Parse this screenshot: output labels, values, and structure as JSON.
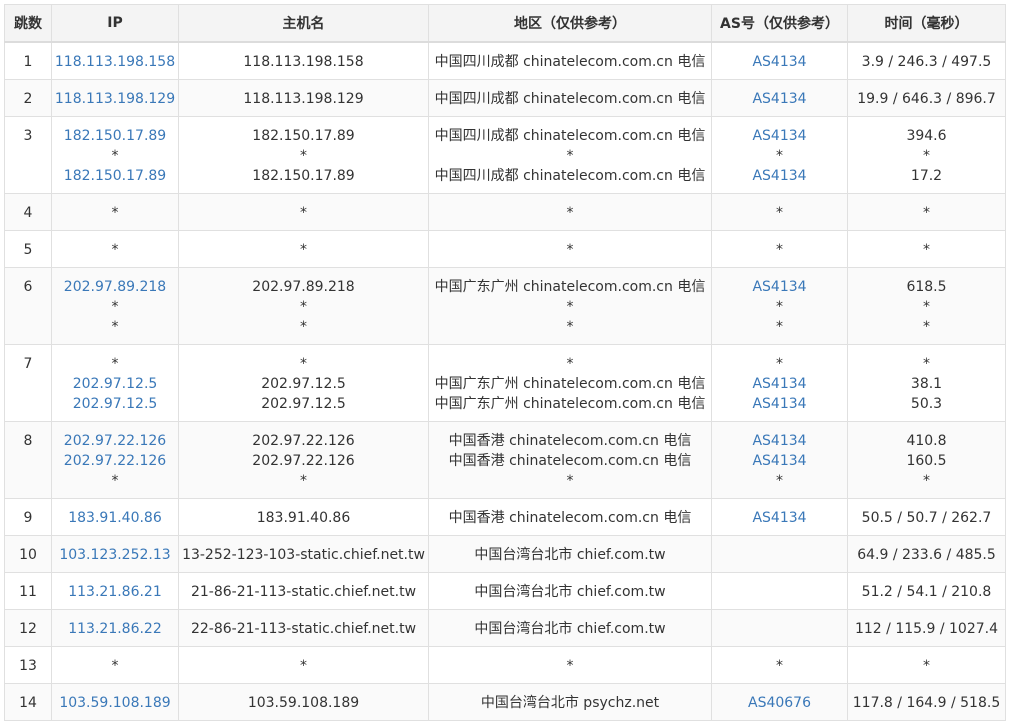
{
  "header": [
    "跳数",
    "IP",
    "主机名",
    "地区（仅供参考）",
    "AS号（仅供参考）",
    "时间（毫秒）"
  ],
  "rows": [
    {
      "hop": "1",
      "ip": [
        "118.113.198.158"
      ],
      "host": [
        "118.113.198.158"
      ],
      "region": [
        "中国四川成都 chinatelecom.com.cn 电信"
      ],
      "asn": [
        "AS4134"
      ],
      "time": [
        "3.9 / 246.3 / 497.5"
      ]
    },
    {
      "hop": "2",
      "ip": [
        "118.113.198.129"
      ],
      "host": [
        "118.113.198.129"
      ],
      "region": [
        "中国四川成都 chinatelecom.com.cn 电信"
      ],
      "asn": [
        "AS4134"
      ],
      "time": [
        "19.9 / 646.3 / 896.7"
      ]
    },
    {
      "hop": "3",
      "ip": [
        "182.150.17.89",
        "*",
        "182.150.17.89"
      ],
      "host": [
        "182.150.17.89",
        "*",
        "182.150.17.89"
      ],
      "region": [
        "中国四川成都 chinatelecom.com.cn 电信",
        "*",
        "中国四川成都 chinatelecom.com.cn 电信"
      ],
      "asn": [
        "AS4134",
        "*",
        "AS4134"
      ],
      "time": [
        "394.6",
        "*",
        "17.2"
      ]
    },
    {
      "hop": "4",
      "ip": [
        "*"
      ],
      "host": [
        "*"
      ],
      "region": [
        "*"
      ],
      "asn": [
        "*"
      ],
      "time": [
        "*"
      ]
    },
    {
      "hop": "5",
      "ip": [
        "*"
      ],
      "host": [
        "*"
      ],
      "region": [
        "*"
      ],
      "asn": [
        "*"
      ],
      "time": [
        "*"
      ]
    },
    {
      "hop": "6",
      "ip": [
        "202.97.89.218",
        "*",
        "*"
      ],
      "host": [
        "202.97.89.218",
        "*",
        "*"
      ],
      "region": [
        "中国广东广州 chinatelecom.com.cn 电信",
        "*",
        "*"
      ],
      "asn": [
        "AS4134",
        "*",
        "*"
      ],
      "time": [
        "618.5",
        "*",
        "*"
      ]
    },
    {
      "hop": "7",
      "ip": [
        "*",
        "202.97.12.5",
        "202.97.12.5"
      ],
      "host": [
        "*",
        "202.97.12.5",
        "202.97.12.5"
      ],
      "region": [
        "*",
        "中国广东广州 chinatelecom.com.cn 电信",
        "中国广东广州 chinatelecom.com.cn 电信"
      ],
      "asn": [
        "*",
        "AS4134",
        "AS4134"
      ],
      "time": [
        "*",
        "38.1",
        "50.3"
      ]
    },
    {
      "hop": "8",
      "ip": [
        "202.97.22.126",
        "202.97.22.126",
        "*"
      ],
      "host": [
        "202.97.22.126",
        "202.97.22.126",
        "*"
      ],
      "region": [
        "中国香港 chinatelecom.com.cn 电信",
        "中国香港 chinatelecom.com.cn 电信",
        "*"
      ],
      "asn": [
        "AS4134",
        "AS4134",
        "*"
      ],
      "time": [
        "410.8",
        "160.5",
        "*"
      ]
    },
    {
      "hop": "9",
      "ip": [
        "183.91.40.86"
      ],
      "host": [
        "183.91.40.86"
      ],
      "region": [
        "中国香港 chinatelecom.com.cn 电信"
      ],
      "asn": [
        "AS4134"
      ],
      "time": [
        "50.5 / 50.7 / 262.7"
      ]
    },
    {
      "hop": "10",
      "ip": [
        "103.123.252.13"
      ],
      "host": [
        "13-252-123-103-static.chief.net.tw"
      ],
      "region": [
        "中国台湾台北市 chief.com.tw"
      ],
      "asn": [
        ""
      ],
      "time": [
        "64.9 / 233.6 / 485.5"
      ]
    },
    {
      "hop": "11",
      "ip": [
        "113.21.86.21"
      ],
      "host": [
        "21-86-21-113-static.chief.net.tw"
      ],
      "region": [
        "中国台湾台北市 chief.com.tw"
      ],
      "asn": [
        ""
      ],
      "time": [
        "51.2 / 54.1 / 210.8"
      ]
    },
    {
      "hop": "12",
      "ip": [
        "113.21.86.22"
      ],
      "host": [
        "22-86-21-113-static.chief.net.tw"
      ],
      "region": [
        "中国台湾台北市 chief.com.tw"
      ],
      "asn": [
        ""
      ],
      "time": [
        "112 / 115.9 / 1027.4"
      ]
    },
    {
      "hop": "13",
      "ip": [
        "*"
      ],
      "host": [
        "*"
      ],
      "region": [
        "*"
      ],
      "asn": [
        "*"
      ],
      "time": [
        "*"
      ]
    },
    {
      "hop": "14",
      "ip": [
        "103.59.108.189"
      ],
      "host": [
        "103.59.108.189"
      ],
      "region": [
        "中国台湾台北市 psychz.net"
      ],
      "asn": [
        "AS40676"
      ],
      "time": [
        "117.8 / 164.9 / 518.5"
      ]
    }
  ],
  "colors": {
    "link": "#3a78b8",
    "text": "#333333",
    "header_bg": "#f4f4f4",
    "border": "#e0e0e0"
  }
}
